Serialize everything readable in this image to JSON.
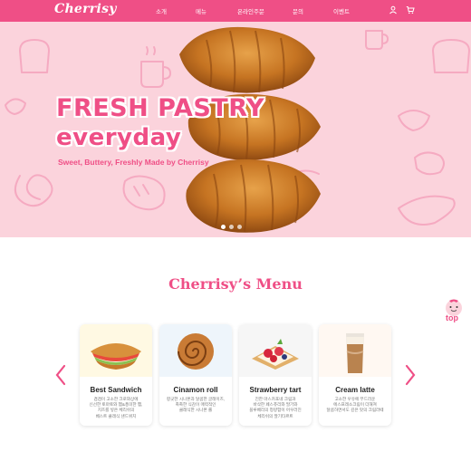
{
  "brand": {
    "logo": "Cherrisy",
    "accent": "#ef4f86",
    "hero_bg": "#fbd3dc"
  },
  "nav": {
    "items": [
      "소개",
      "메뉴",
      "온라인주문",
      "문의",
      "이벤트"
    ],
    "icons": [
      "user-icon",
      "cart-icon"
    ]
  },
  "hero": {
    "title_line1": "FRESH PASTRY",
    "title_line2": "everyday",
    "subtitle": "Sweet, Buttery, Freshly Made by Cherrisy",
    "slide_count": 3,
    "active_slide": 0
  },
  "menu": {
    "title": "Cherrisy’s Menu",
    "items": [
      {
        "name": "Best Sandwich",
        "desc": [
          "겹겹이 고소한 크로와상에",
          "신선한 토마토와 햄&풍미한 햄,",
          "치즈를 넣은 체리쉬의",
          "베스트 클래식 샌드위치"
        ],
        "icon": "sandwich-image"
      },
      {
        "name": "Cinamon roll",
        "desc": [
          "향긋한 시나몬과 달콤한 글레이즈,",
          "촉촉한 식감이 매력적인",
          "클래식한 시나몬 롤"
        ],
        "icon": "cinnamon-roll-image"
      },
      {
        "name": "Strawberry tart",
        "desc": [
          "진한 마스카포네 크림과",
          "바삭한 페스츄리와 딸기와",
          "블루베리의 청량함이 어우러진",
          "체리쉬의 딸기타르트"
        ],
        "icon": "strawberry-tart-image"
      },
      {
        "name": "Cream latte",
        "desc": [
          "고소한 우유에 부드러운",
          "에스프레소크림이 더해져",
          "달콤하면서도 깊은 맛의 크림라떼"
        ],
        "icon": "cream-latte-image"
      }
    ]
  },
  "top_button": {
    "label": "top"
  }
}
